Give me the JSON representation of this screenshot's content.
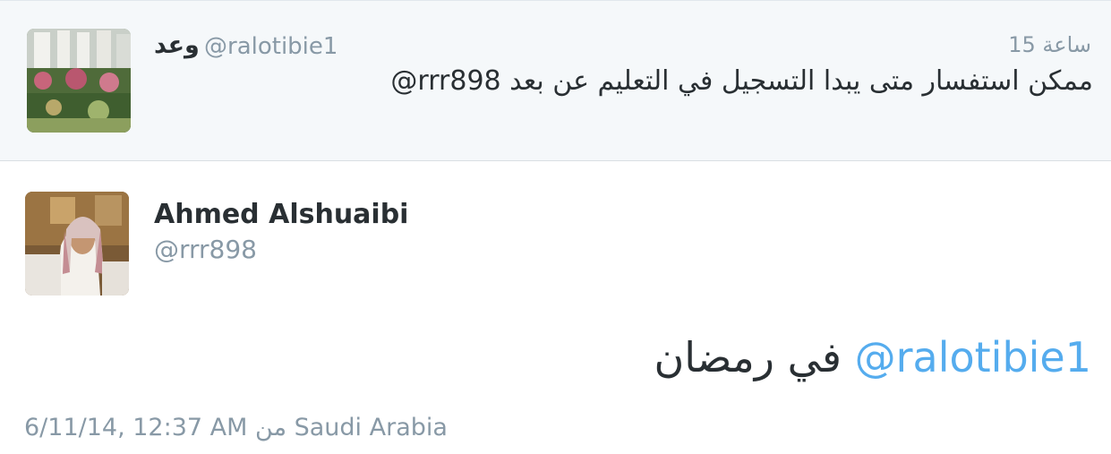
{
  "parent": {
    "display_name": "وعد",
    "handle": "@ralotibie1",
    "timestamp": "15 ساعة",
    "text": "@rrr898 ممكن استفسار متى يبدا التسجيل في التعليم عن بعد"
  },
  "tweet": {
    "display_name": "Ahmed Alshuaibi",
    "handle": "@rrr898",
    "mention": "@ralotibie1",
    "body": "في رمضان",
    "datetime": "6/11/14, 12:37 AM",
    "location_prefix": "من",
    "location": "Saudi Arabia"
  },
  "colors": {
    "mention": "#55acee",
    "secondary_text": "#8899a6",
    "primary_text": "#292f33",
    "parent_background": "#f5f8fa"
  }
}
